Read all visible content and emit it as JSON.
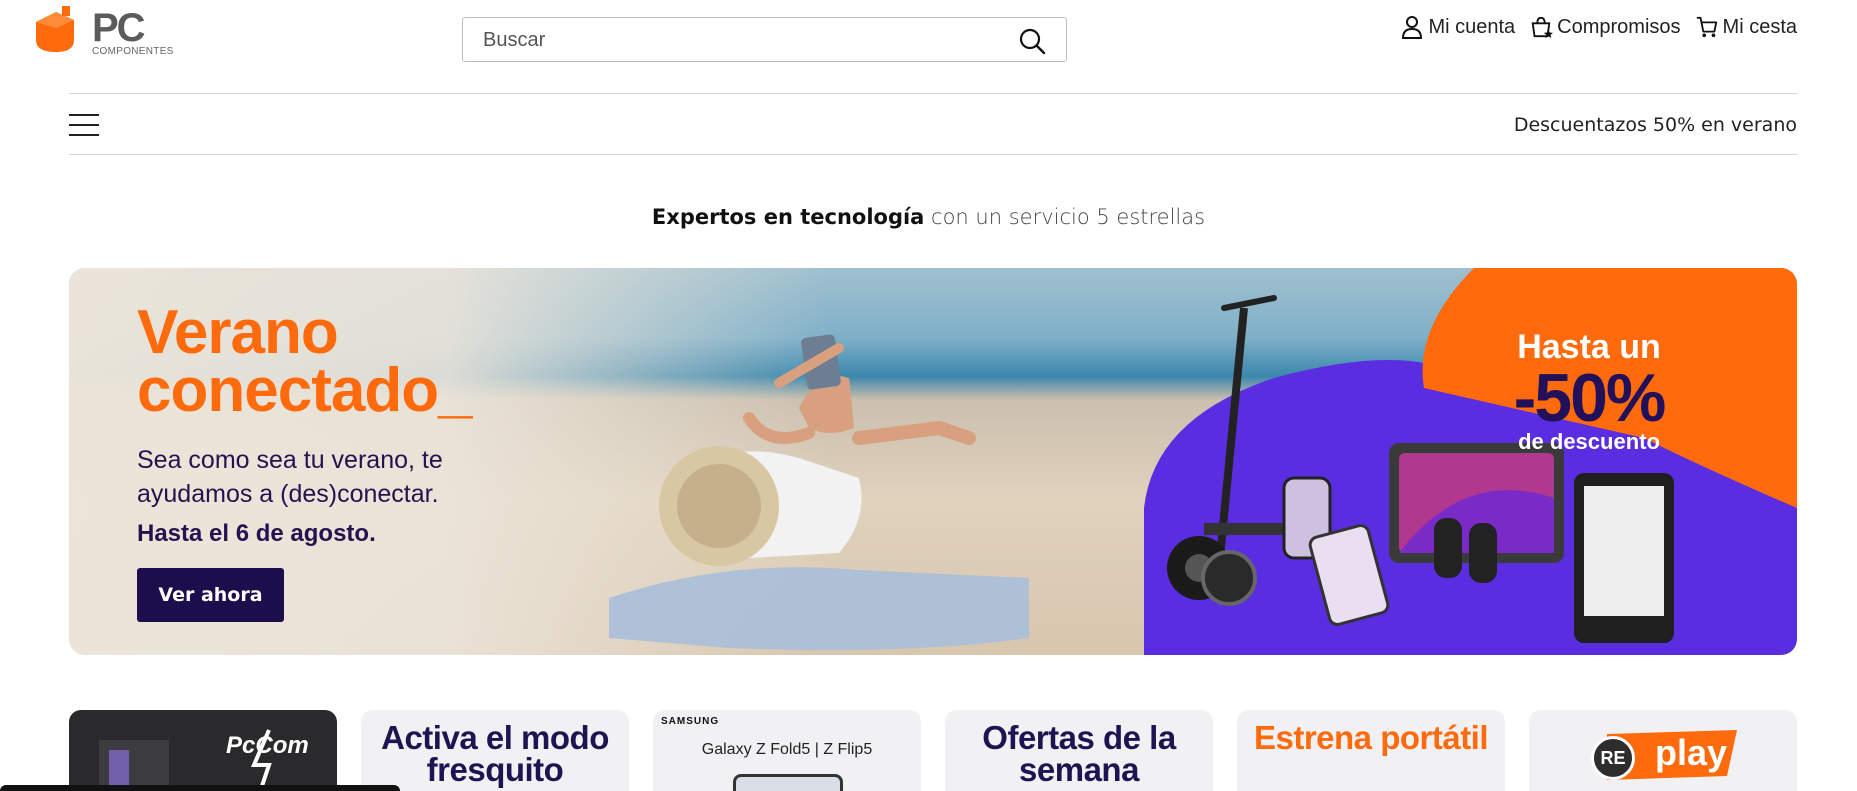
{
  "header": {
    "logo_text": "PC",
    "logo_sub": "COMPONENTES",
    "search": {
      "placeholder": "Buscar"
    },
    "nav": {
      "account": "Mi cuenta",
      "commitments": "Compromisos",
      "cart": "Mi cesta"
    }
  },
  "subnav": {
    "promo_link": "Descuentazos 50% en verano"
  },
  "tagline": {
    "bold": "Expertos en tecnología",
    "rest": " con un servicio 5 estrellas"
  },
  "hero": {
    "title_line1": "Verano",
    "title_line2": "conectado_",
    "subtitle": "Sea como sea tu verano, te ayudamos a (des)conectar.",
    "date": "Hasta el 6 de agosto.",
    "cta": "Ver ahora",
    "discount_line1": "Hasta un",
    "discount_big": "-50%",
    "discount_line3": "de descuento"
  },
  "cards": [
    {
      "label": "PcCom"
    },
    {
      "label": "Activa el modo fresquito"
    },
    {
      "brand": "SAMSUNG",
      "label": "Galaxy Z Fold5 | Z Flip5"
    },
    {
      "label": "Ofertas de la semana"
    },
    {
      "label": "Estrena portátil"
    },
    {
      "re": "RE",
      "label": "play"
    }
  ],
  "colors": {
    "brand_orange": "#ff6a0c",
    "navy": "#1c0d4d",
    "purple": "#5b2be0"
  }
}
